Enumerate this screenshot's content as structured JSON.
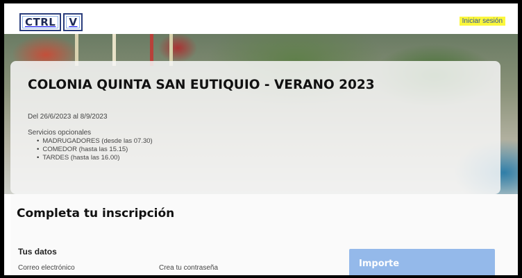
{
  "header": {
    "logo_left": "CTRL",
    "logo_right": "V",
    "login_label": "Iniciar sesión"
  },
  "event": {
    "title": "COLONIA QUINTA SAN EUTIQUIO - VERANO 2023",
    "dates": "Del 26/6/2023 al 8/9/2023",
    "services_label": "Servicios opcionales",
    "services": [
      "MADRUGADORES (desde las 07.30)",
      "COMEDOR (hasta las 15.15)",
      "TARDES (hasta las 16.00)"
    ]
  },
  "form": {
    "title": "Completa tu inscripción",
    "section_label": "Tus datos",
    "email_label": "Correo electrónico",
    "password_label": "Crea tu contraseña",
    "amount_label": "Importe"
  },
  "colors": {
    "highlight": "#fbf73b",
    "link": "#2d4f9e",
    "amount_panel": "#94b9ea"
  }
}
